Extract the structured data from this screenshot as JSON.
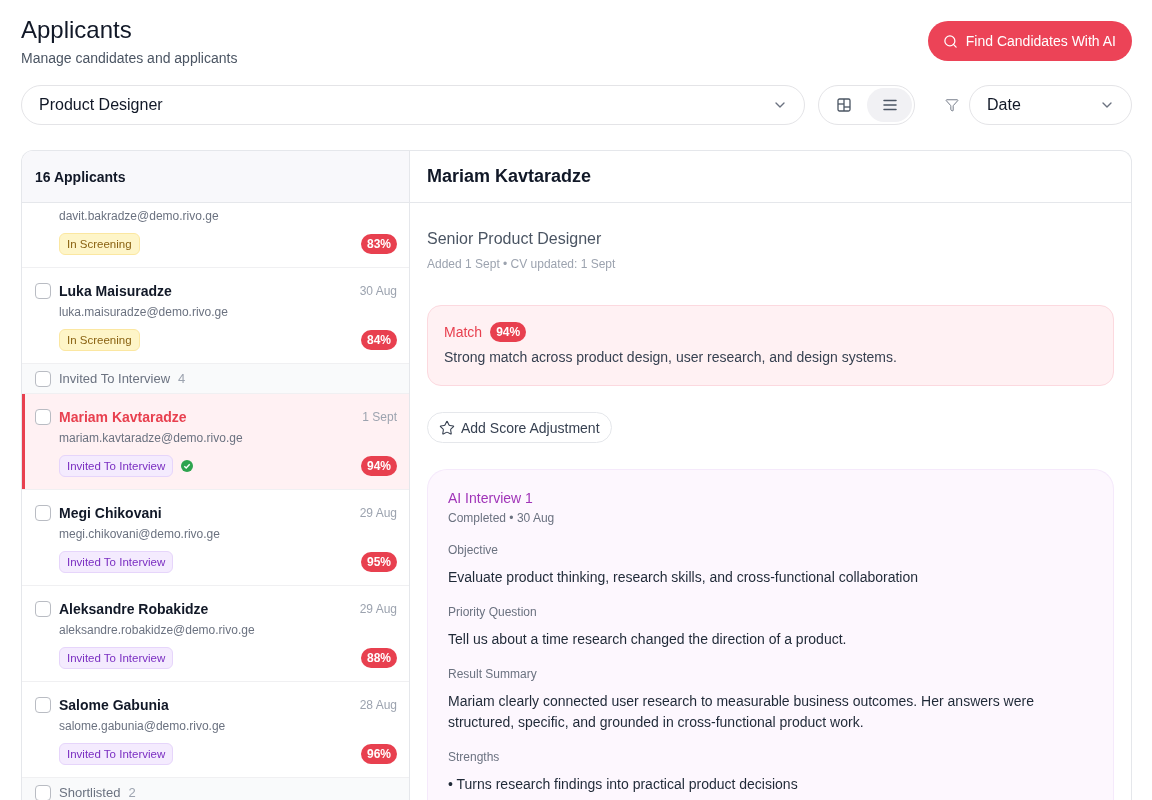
{
  "header": {
    "title": "Applicants",
    "subtitle": "Manage candidates and applicants",
    "action": "Find Candidates With AI"
  },
  "toolbar": {
    "job_select": {
      "value": "Product Designer"
    },
    "view_modes": [
      {
        "kind": "board",
        "selected": false
      },
      {
        "kind": "list",
        "selected": true
      }
    ],
    "sort_select": {
      "value": "Date"
    }
  },
  "applicants": {
    "title": "16 Applicants",
    "items": [
      {
        "kind": "applicant",
        "email": "davit.bakradze@demo.rivo.ge",
        "status": {
          "kind": "screening",
          "label": "In Screening"
        },
        "score": "83%",
        "selected": false,
        "verified": false
      },
      {
        "kind": "applicant",
        "name": "Luka Maisuradze",
        "date": "30 Aug",
        "email": "luka.maisuradze@demo.rivo.ge",
        "status": {
          "kind": "screening",
          "label": "In Screening"
        },
        "score": "84%",
        "checked": false,
        "selected": false,
        "verified": false
      },
      {
        "kind": "group",
        "label": "Invited To Interview",
        "count": "4",
        "checked": false
      },
      {
        "kind": "applicant",
        "name": "Mariam Kavtaradze",
        "date": "1 Sept",
        "email": "mariam.kavtaradze@demo.rivo.ge",
        "status": {
          "kind": "interview",
          "label": "Invited To Interview"
        },
        "score": "94%",
        "checked": false,
        "selected": true,
        "verified": true
      },
      {
        "kind": "applicant",
        "name": "Megi Chikovani",
        "date": "29 Aug",
        "email": "megi.chikovani@demo.rivo.ge",
        "status": {
          "kind": "interview",
          "label": "Invited To Interview"
        },
        "score": "95%",
        "checked": false,
        "selected": false,
        "verified": false
      },
      {
        "kind": "applicant",
        "name": "Aleksandre Robakidze",
        "date": "29 Aug",
        "email": "aleksandre.robakidze@demo.rivo.ge",
        "status": {
          "kind": "interview",
          "label": "Invited To Interview"
        },
        "score": "88%",
        "checked": false,
        "selected": false,
        "verified": false
      },
      {
        "kind": "applicant",
        "name": "Salome Gabunia",
        "date": "28 Aug",
        "email": "salome.gabunia@demo.rivo.ge",
        "status": {
          "kind": "interview",
          "label": "Invited To Interview"
        },
        "score": "96%",
        "checked": false,
        "selected": false,
        "verified": false
      },
      {
        "kind": "group",
        "label": "Shortlisted",
        "count": "2",
        "checked": false
      }
    ]
  },
  "detail": {
    "name": "Mariam Kavtaradze",
    "role": "Senior Product Designer",
    "meta": "Added 1 Sept • CV updated: 1 Sept",
    "match": {
      "label": "Match",
      "score": "94%",
      "summary": "Strong match across product design, user research, and design systems."
    },
    "adjust_button": "Add Score Adjustment",
    "interview": {
      "title": "AI Interview 1",
      "meta": "Completed • 30 Aug",
      "sections": [
        {
          "label": "Objective",
          "text": "Evaluate product thinking, research skills, and cross-functional collaboration"
        },
        {
          "label": "Priority Question",
          "text": "Tell us about a time research changed the direction of a product."
        },
        {
          "label": "Result Summary",
          "text": "Mariam clearly connected user research to measurable business outcomes. Her answers were structured, specific, and grounded in cross-functional product work."
        },
        {
          "label": "Strengths",
          "text": "• Turns research findings into practical product decisions"
        }
      ]
    }
  }
}
